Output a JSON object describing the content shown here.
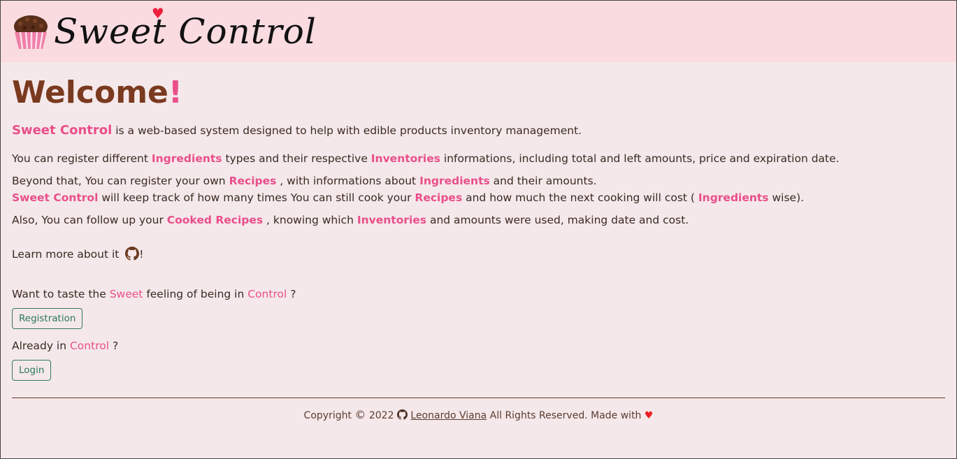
{
  "header": {
    "logo_text": "Sweet Control"
  },
  "main": {
    "title": "Welcome",
    "title_exclaim": "!",
    "intro": {
      "brand": "Sweet Control",
      "text": " is a web-based system designed to help with edible products inventory management."
    },
    "p2": {
      "a": "You can register different ",
      "ingredients": "Ingredients",
      "b": " types and their respective ",
      "inventories": "Inventories",
      "c": " informations, including total and left amounts, price and expiration date."
    },
    "p3": {
      "a": "Beyond that, You can register your own ",
      "recipes": "Recipes",
      "b": " , with informations about ",
      "ingredients": "Ingredients",
      "c": " and their amounts."
    },
    "p4": {
      "brand": "Sweet Control",
      "a": " will keep track of how many times You can still cook your ",
      "recipes": "Recipes",
      "b": " and how much the next cooking will cost ( ",
      "ingredients": "Ingredients",
      "c": " wise)."
    },
    "p5": {
      "a": "Also, You can follow up your ",
      "cooked": "Cooked Recipes",
      "b": " , knowing which ",
      "inventories": "Inventories",
      "c": " and amounts were used, making date and cost."
    },
    "learn_more": "Learn more about it ",
    "learn_more_end": "!",
    "taste": {
      "a": "Want to taste the ",
      "sweet": "Sweet",
      "b": " feeling of being in ",
      "control": "Control",
      "c": " ?"
    },
    "registration_button": "Registration",
    "already": {
      "a": "Already in ",
      "control": "Control",
      "b": " ?"
    },
    "login_button": "Login"
  },
  "footer": {
    "copyright": "Copyright ",
    "symbol": "©",
    "year": " 2022 ",
    "author": "Leonardo Viana",
    "rest": " All Rights Reserved. Made with ",
    "heart": "♥"
  },
  "colors": {
    "accent": "#e94f8a",
    "title": "#7a3a1f",
    "header_bg": "#f9dbe0",
    "page_bg": "#f5e8ea",
    "button": "#2a7a55"
  }
}
